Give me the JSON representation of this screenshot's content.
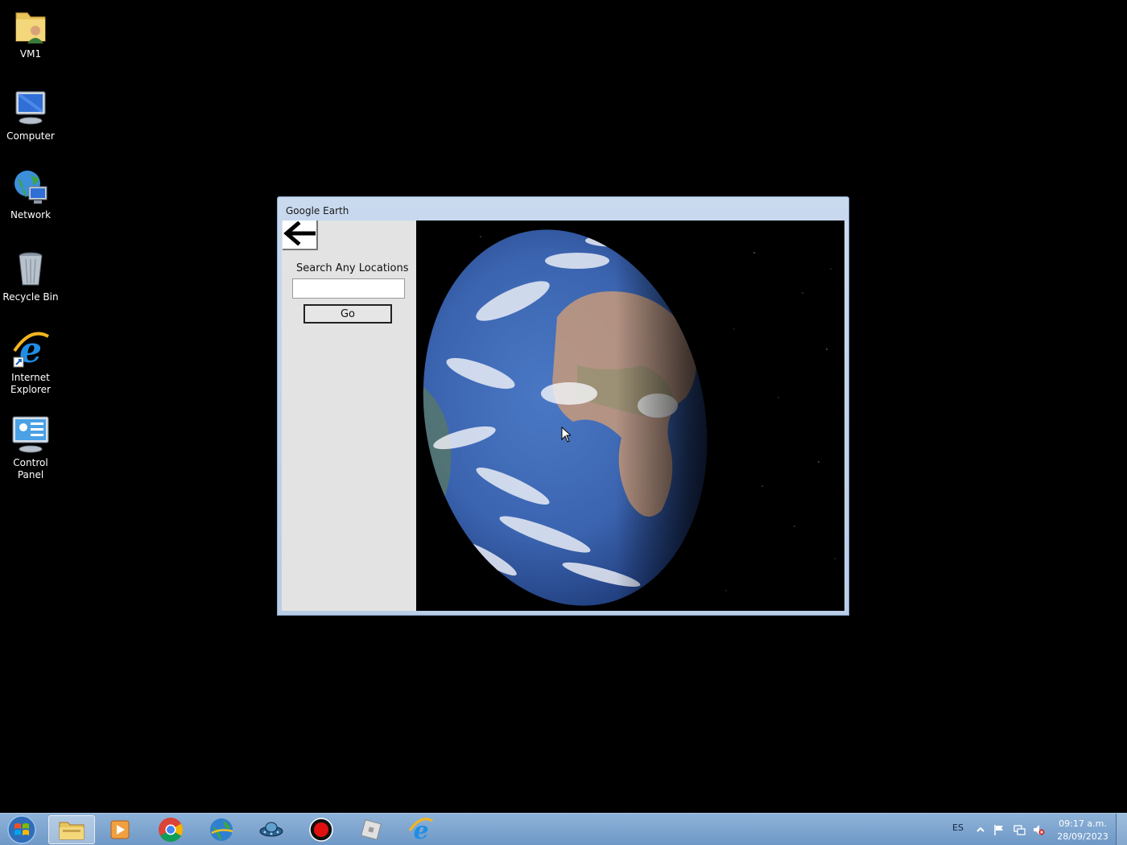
{
  "desktop": {
    "icons": [
      {
        "label": "VM1"
      },
      {
        "label": "Computer"
      },
      {
        "label": "Network"
      },
      {
        "label": "Recycle Bin"
      },
      {
        "label": "Internet Explorer"
      },
      {
        "label": "Control Panel"
      }
    ]
  },
  "window": {
    "title": "Google Earth",
    "back_icon": "back-arrow-icon",
    "search_label": "Search Any Locations",
    "search_value": "",
    "go_label": "Go"
  },
  "taskbar": {
    "items": [
      "file-explorer-icon",
      "media-player-icon",
      "chrome-icon",
      "globe-download-icon",
      "spaceship-icon",
      "record-icon",
      "roblox-icon",
      "internet-explorer-icon"
    ],
    "language": "ES",
    "time": "09:17 a.m.",
    "date": "28/09/2023"
  },
  "colors": {
    "taskbar": "#7aa3cf",
    "window_frame": "#c2d4eb",
    "panel": "#e3e3e3",
    "desktop": "#000000"
  }
}
